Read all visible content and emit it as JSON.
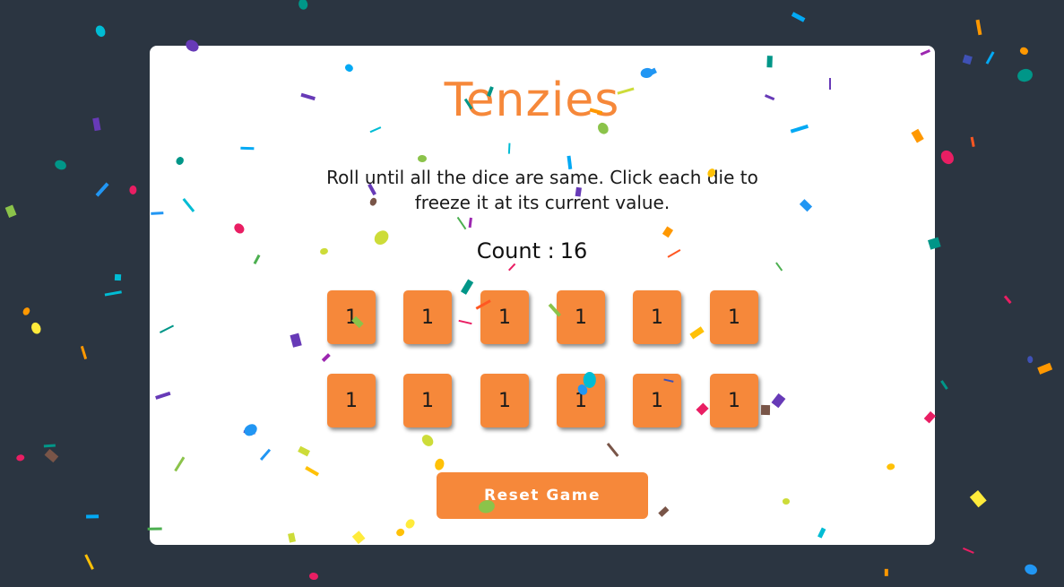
{
  "game": {
    "title": "Tenzies",
    "instructions": "Roll until all the dice are same. Click each die to freeze it at its current value.",
    "count_label": "Count :",
    "count_value": "16",
    "dice": [
      "1",
      "1",
      "1",
      "1",
      "1",
      "1",
      "1",
      "1",
      "1",
      "1",
      "1",
      "1"
    ],
    "reset_label": "Reset Game"
  },
  "colors": {
    "background": "#2b3541",
    "card": "#ffffff",
    "accent": "#f6883a",
    "confetti": [
      "#e91e63",
      "#9c27b0",
      "#673ab7",
      "#3f51b5",
      "#2196f3",
      "#03a9f4",
      "#00bcd4",
      "#009688",
      "#4caf50",
      "#8bc34a",
      "#cddc39",
      "#ffeb3b",
      "#ffc107",
      "#ff9800",
      "#ff5722",
      "#795548"
    ]
  }
}
